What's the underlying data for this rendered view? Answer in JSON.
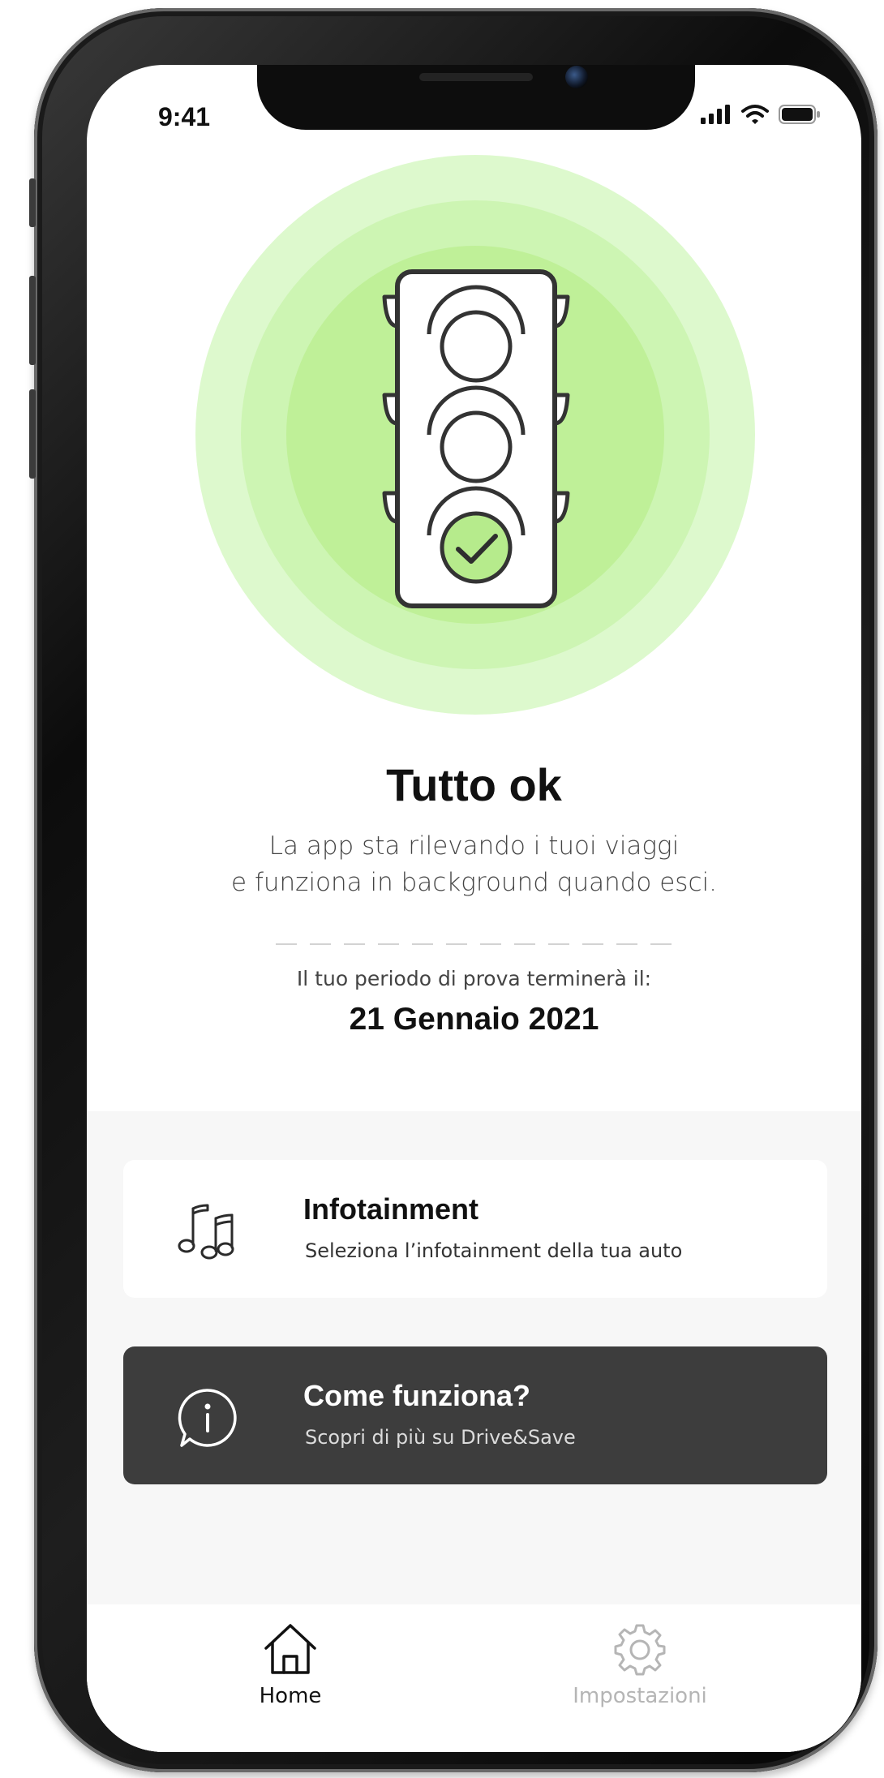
{
  "status_bar": {
    "time": "9:41"
  },
  "hero": {
    "title": "Tutto ok",
    "subtitle_line1": "La app sta rilevando i tuoi viaggi",
    "subtitle_line2": "e funziona in background quando esci.",
    "trial_label": "Il tuo periodo di prova terminerà il:",
    "trial_date": "21 Gennaio 2021",
    "colors": {
      "circle_outer": "#ddf9cd",
      "circle_mid": "#cdf5b3",
      "circle_inner": "#bff098",
      "active_light": "#b6eb8c"
    }
  },
  "cards": {
    "infotainment": {
      "title": "Infotainment",
      "subtitle": "Seleziona l’infotainment della tua auto",
      "icon": "music-notes-icon"
    },
    "how_it_works": {
      "title": "Come funziona?",
      "subtitle": "Scopri di più su Drive&Save",
      "icon": "info-bubble-icon"
    }
  },
  "tabbar": {
    "home": {
      "label": "Home",
      "icon": "home-icon",
      "active": true
    },
    "settings": {
      "label": "Impostazioni",
      "icon": "gear-icon",
      "active": false
    }
  }
}
